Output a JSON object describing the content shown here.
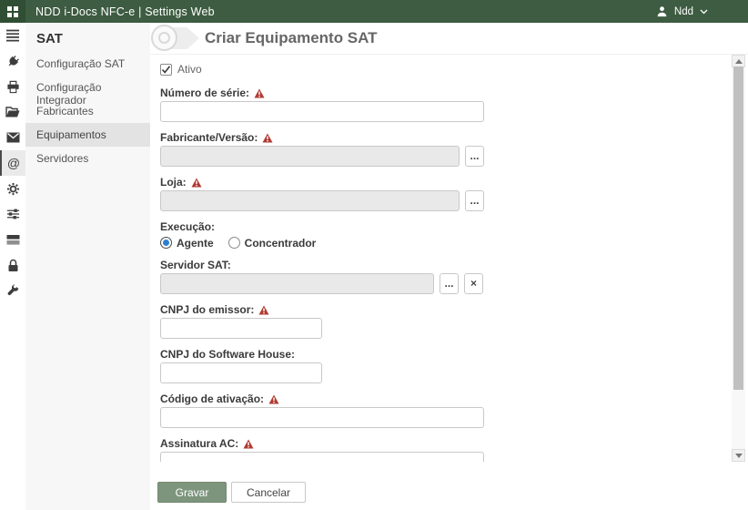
{
  "topbar": {
    "title": "NDD i-Docs NFC-e | Settings Web",
    "user_name": "Ndd"
  },
  "icon_sidebar": [
    "menu",
    "plug",
    "printer",
    "folder-open",
    "mail",
    "at-sign",
    "gear",
    "sliders",
    "server",
    "lock",
    "wrench"
  ],
  "icon_glyphs": {
    "at": "@"
  },
  "sidebar": {
    "title": "SAT",
    "items": [
      {
        "label": "Configuração SAT",
        "selected": false
      },
      {
        "label": "Configuração Integrador",
        "selected": false
      },
      {
        "label": "Fabricantes",
        "selected": false
      },
      {
        "label": "Equipamentos",
        "selected": true
      },
      {
        "label": "Servidores",
        "selected": false
      }
    ]
  },
  "page": {
    "title": "Criar Equipamento SAT"
  },
  "form": {
    "ativo": {
      "label": "Ativo",
      "checked": true
    },
    "numero_serie": {
      "label": "Número de série:",
      "required": true,
      "value": ""
    },
    "fabricante_versao": {
      "label": "Fabricante/Versão:",
      "required": true,
      "value": "",
      "disabled": true,
      "browse_label": "..."
    },
    "loja": {
      "label": "Loja:",
      "required": true,
      "value": "",
      "disabled": true,
      "browse_label": "..."
    },
    "execucao": {
      "label": "Execução:",
      "options": [
        {
          "label": "Agente",
          "selected": true
        },
        {
          "label": "Concentrador",
          "selected": false
        }
      ]
    },
    "servidor_sat": {
      "label": "Servidor SAT:",
      "required": false,
      "value": "",
      "disabled": true,
      "browse_label": "...",
      "clear_label": "×"
    },
    "cnpj_emissor": {
      "label": "CNPJ do emissor:",
      "required": true,
      "value": ""
    },
    "cnpj_software_house": {
      "label": "CNPJ do Software House:",
      "required": false,
      "value": ""
    },
    "codigo_ativacao": {
      "label": "Código de ativação:",
      "required": true,
      "value": ""
    },
    "assinatura_ac": {
      "label": "Assinatura AC:",
      "required": true,
      "value": ""
    }
  },
  "footer": {
    "save_label": "Gravar",
    "cancel_label": "Cancelar"
  },
  "colors": {
    "topbar_green": "#3d5c41",
    "save_button_green": "#7d957d",
    "required_red": "#b03a32",
    "radio_selected_blue": "#2a7fd0",
    "sidebar_bg": "#f7f7f7",
    "selected_item_bg": "#e3e3e3"
  }
}
